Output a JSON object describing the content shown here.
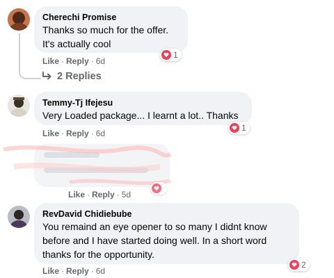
{
  "comments": [
    {
      "author": "Cherechi Promise",
      "lines": [
        "Thanks so much for the offer.",
        "It's actually cool"
      ],
      "reaction_count": "1",
      "like_label": "Like",
      "reply_label": "Reply",
      "time": "6d",
      "replies_label": "2 Replies"
    },
    {
      "author": "Temmy-Tj Ifejesu",
      "lines": [
        "Very Loaded package... I learnt a lot.. Thanks"
      ],
      "reaction_count": "1",
      "like_label": "Like",
      "reply_label": "Reply",
      "time": "6d"
    },
    {
      "author": "",
      "lines": [],
      "reaction_count": "",
      "like_label": "Like",
      "reply_label": "Reply",
      "time": "5d"
    },
    {
      "author": "RevDavid Chidiebube",
      "lines": [
        "You remaind an eye opener to so many I didnt know",
        "before and I have started doing well. In a short word",
        "thanks for the opportunity."
      ],
      "reaction_count": "2",
      "like_label": "Like",
      "reply_label": "Reply",
      "time": "6d"
    }
  ],
  "colors": {
    "bubble": "#f0f2f5",
    "meta_text": "#65676b",
    "heart": "#f33e58",
    "thread_line": "#ced0d4"
  },
  "icons": {
    "reaction": "heart-icon",
    "replies_arrow": "reply-arrow-icon"
  }
}
